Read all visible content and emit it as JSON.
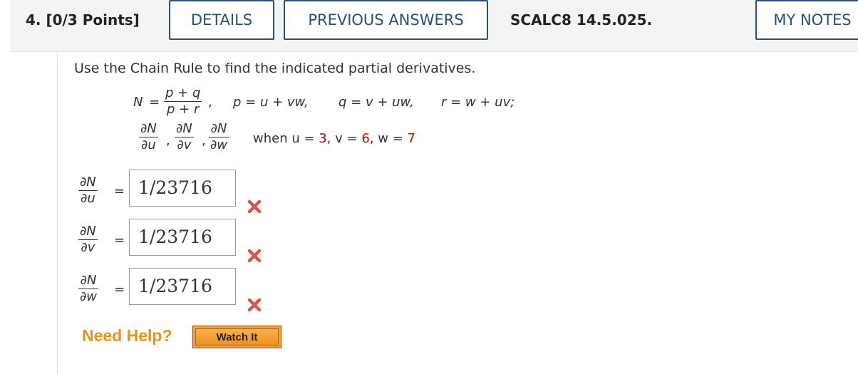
{
  "header": {
    "question_label": "4. [0/3 Points]",
    "details_button": "DETAILS",
    "previous_answers_button": "PREVIOUS ANSWERS",
    "problem_code": "SCALC8 14.5.025.",
    "my_notes_button": "MY NOTES"
  },
  "prompt": "Use the Chain Rule to find the indicated partial derivatives.",
  "math": {
    "N": "N",
    "equals": "=",
    "N_num": "p + q",
    "N_den": "p + r",
    "comma": ",",
    "p_def": "p = u + vw,",
    "q_def": "q = v + uw,",
    "r_def": "r = w + uv;",
    "dN": "∂N",
    "du": "∂u",
    "dv": "∂v",
    "dw": "∂w",
    "when_label": "when u =",
    "u_val": "3",
    "v_label": ", v =",
    "v_val": "6",
    "w_label": ", w =",
    "w_val": "7"
  },
  "answers": [
    {
      "num": "∂N",
      "den": "∂u",
      "eq": "=",
      "value": "1/23716",
      "status": "incorrect"
    },
    {
      "num": "∂N",
      "den": "∂v",
      "eq": "=",
      "value": "1/23716",
      "status": "incorrect"
    },
    {
      "num": "∂N",
      "den": "∂w",
      "eq": "=",
      "value": "1/23716",
      "status": "incorrect"
    }
  ],
  "help": {
    "label": "Need Help?",
    "watch_button": "Watch It"
  },
  "colors": {
    "accent": "#2c4f73",
    "incorrect": "#d9534f",
    "given_values": "#d10000",
    "help": "#e8911c"
  }
}
